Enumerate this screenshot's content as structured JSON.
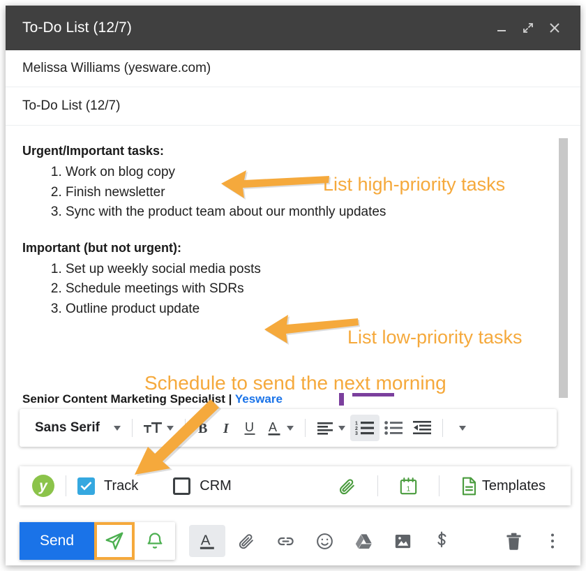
{
  "window": {
    "title": "To-Do List (12/7)",
    "controls": [
      {
        "name": "minimize-button",
        "glyph": "minimize"
      },
      {
        "name": "expand-button",
        "glyph": "expand"
      },
      {
        "name": "close-button",
        "glyph": "close"
      }
    ]
  },
  "compose": {
    "recipient": "Melissa Williams (yesware.com)",
    "subject": "To-Do List (12/7)"
  },
  "body": {
    "sections": [
      {
        "heading": "Urgent/Important tasks:",
        "items": [
          "Work on blog copy",
          "Finish newsletter",
          "Sync with the product team about our monthly updates"
        ]
      },
      {
        "heading": "Important (but not urgent):",
        "items": [
          "Set up weekly social media posts",
          "Schedule meetings with SDRs",
          "Outline product update"
        ]
      }
    ],
    "signature": {
      "title": "Senior Content Marketing Specialist",
      "divider": " | ",
      "company": "Yesware"
    }
  },
  "annotations": [
    {
      "text": "List high-priority tasks",
      "color": "#f5a93c"
    },
    {
      "text": "List low-priority tasks",
      "color": "#f5a93c"
    },
    {
      "text": "Schedule to send the next morning",
      "color": "#f5a93c"
    }
  ],
  "format_toolbar": {
    "font_name": "Sans Serif",
    "items": [
      {
        "name": "font-family-dropdown",
        "label": "Sans Serif"
      },
      {
        "name": "font-size-button",
        "label": "TT"
      },
      {
        "name": "bold-button",
        "label": "B"
      },
      {
        "name": "italic-button",
        "label": "I"
      },
      {
        "name": "underline-button",
        "label": "U"
      },
      {
        "name": "text-color-button",
        "label": "A"
      },
      {
        "name": "align-button",
        "label": "align"
      },
      {
        "name": "numbered-list-button",
        "label": "numbered-list",
        "active": true
      },
      {
        "name": "bulleted-list-button",
        "label": "bulleted-list"
      },
      {
        "name": "indent-less-button",
        "label": "indent"
      },
      {
        "name": "more-format-button",
        "label": "more"
      }
    ]
  },
  "yesware_bar": {
    "logo_letter": "y",
    "track": {
      "label": "Track",
      "checked": true
    },
    "crm": {
      "label": "CRM",
      "checked": false
    },
    "attachment_icon": "paperclip-icon",
    "calendar_icon": "calendar-icon",
    "calendar_day": "1",
    "templates_label": "Templates"
  },
  "send_bar": {
    "send_label": "Send",
    "send_later_name": "send-later-icon",
    "reminder_name": "reminder-bell-icon",
    "icons": [
      {
        "name": "formatting-options-icon",
        "glyph": "A",
        "active": true
      },
      {
        "name": "attach-file-icon",
        "glyph": "paperclip"
      },
      {
        "name": "insert-link-icon",
        "glyph": "link"
      },
      {
        "name": "insert-emoji-icon",
        "glyph": "emoji"
      },
      {
        "name": "google-drive-icon",
        "glyph": "drive"
      },
      {
        "name": "insert-photo-icon",
        "glyph": "image"
      },
      {
        "name": "insert-money-icon",
        "glyph": "dollar"
      },
      {
        "name": "discard-draft-icon",
        "glyph": "trash"
      },
      {
        "name": "more-options-icon",
        "glyph": "kebab"
      }
    ]
  },
  "colors": {
    "titlebar": "#404040",
    "send_button": "#1a73e8",
    "annotation": "#f5a93c",
    "yesware_green": "#8bc34a",
    "track_checkbox": "#35a8e0",
    "highlight_border": "#f5a93c"
  }
}
